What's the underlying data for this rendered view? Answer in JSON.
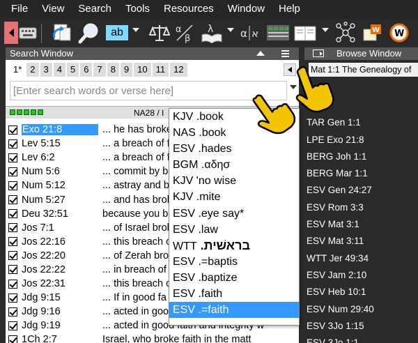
{
  "menu": [
    "File",
    "View",
    "Search",
    "Tools",
    "Resources",
    "Window",
    "Help"
  ],
  "toolbar": {
    "icons": [
      "keyboard-icon",
      "sync-icon",
      "magnifier-icon",
      "ab-icon",
      "scales-icon",
      "alpha-beta-icon",
      "lambda-book-icon",
      "alpha-aleph-icon",
      "parallel-columns-icon",
      "book-icon",
      "network-icon",
      "word-books-icon",
      "w-logo-icon"
    ],
    "ab_label": "ab"
  },
  "search_window": {
    "title": "Search Window",
    "tabs": [
      "1*",
      "2",
      "3",
      "4",
      "5",
      "6",
      "7",
      "8",
      "9",
      "10",
      "11",
      "12"
    ],
    "placeholder": "[Enter search words or verse here]",
    "status_version": "NA28 / I",
    "results": [
      {
        "ref": "Exo 21:8",
        "text": "... he has broke"
      },
      {
        "ref": "Lev 5:15",
        "text": "... a breach of fa"
      },
      {
        "ref": "Lev 6:2",
        "text": "... a breach of fa"
      },
      {
        "ref": "Num 5:6",
        "text": "... commit by bre"
      },
      {
        "ref": "Num 5:12",
        "text": "... astray and br"
      },
      {
        "ref": "Num 5:27",
        "text": "... and has brok"
      },
      {
        "ref": "Deu 32:51",
        "text": "because you br"
      },
      {
        "ref": "Jos 7:1",
        "text": "... of Israel brok"
      },
      {
        "ref": "Jos 22:16",
        "text": "... this breach o"
      },
      {
        "ref": "Jos 22:20",
        "text": "... of Zerah brok"
      },
      {
        "ref": "Jos 22:22",
        "text": "... in breach of"
      },
      {
        "ref": "Jos 22:31",
        "text": "... this breach o"
      },
      {
        "ref": "Jdg 9:15",
        "text": "... If in good fa"
      },
      {
        "ref": "Jdg 9:16",
        "text": "... acted in goo"
      },
      {
        "ref": "Jdg 9:19",
        "text": "... acted in good faith and integrity w"
      },
      {
        "ref": "1Ch 2:7",
        "text": "Israel, who broke faith in the matt"
      }
    ]
  },
  "autocomplete": [
    {
      "prefix": "KJV",
      "word": " .book"
    },
    {
      "prefix": "NAS",
      "word": " .book"
    },
    {
      "prefix": "ESV",
      "word": " .hades"
    },
    {
      "prefix": "BGM",
      "word": " .αδησ"
    },
    {
      "prefix": "KJV",
      "word": " 'no wise"
    },
    {
      "prefix": "KJV",
      "word": " .mite"
    },
    {
      "prefix": "ESV",
      "word": " .eye say*"
    },
    {
      "prefix": "ESV",
      "word": " .law"
    },
    {
      "prefix": "WTT",
      "word": " .בראשׁית"
    },
    {
      "prefix": "ESV",
      "word": " .=baptis"
    },
    {
      "prefix": "ESV",
      "word": " .baptize"
    },
    {
      "prefix": "ESV",
      "word": " .faith"
    },
    {
      "prefix": "ESV",
      "word": " .=faith"
    }
  ],
  "browse_window": {
    "title": "Browse Window",
    "verse_title": "Mat 1:1 The Genealogy of",
    "history": [
      "t 1:1",
      "TAR Gen 1:1",
      "LPE Exo 21:8",
      "BERG Joh 1:1",
      "BERG Mar 1:1",
      "ESV Gen 24:27",
      "ESV Rom 3:3",
      "ESV Mat 3:1",
      "ESV Mat 3:11",
      "WTT Jer 49:34",
      "ESV Jam 2:10",
      "ESV Heb 10:1",
      "ESV Num 29:40",
      "ESV 3Jo 1:15",
      "ESV 3Jo 1:1"
    ]
  },
  "colors": {
    "selection": "#3399ff",
    "dark_bg": "#2b2b2b",
    "header": "#555555",
    "status_green": "#22c722",
    "hand": "#f5c400"
  }
}
